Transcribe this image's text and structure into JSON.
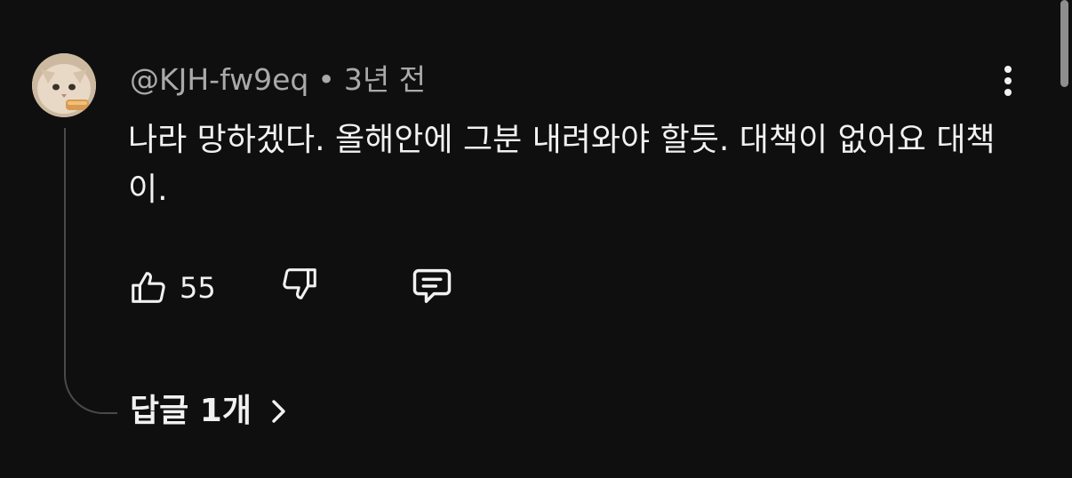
{
  "comment": {
    "author": "@KJH-fw9eq",
    "separator": "•",
    "time": "3년 전",
    "text": "나라 망하겠다. 올해안에 그분 내려와야 할듯. 대책이 없어요 대책이.",
    "like_count": "55",
    "avatar_icon": "cat-avatar",
    "menu_icon": "more-vertical-icon"
  },
  "actions": {
    "like_icon": "thumbs-up-icon",
    "dislike_icon": "thumbs-down-icon",
    "reply_icon": "comment-reply-icon"
  },
  "replies": {
    "label": "답글 1개",
    "chevron_icon": "chevron-right-icon"
  },
  "colors": {
    "background": "#0f0f0f",
    "text": "#f1f1f1",
    "secondary_text": "#aaaaaa",
    "thread_line": "#4a4a4a"
  }
}
